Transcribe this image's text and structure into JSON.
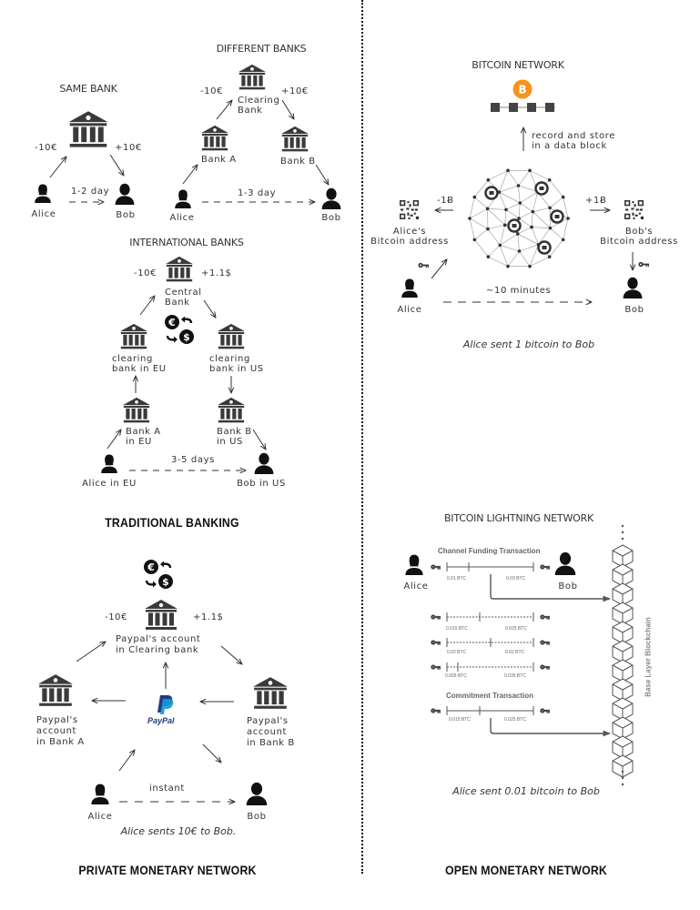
{
  "traditional_banking": {
    "section_title": "TRADITIONAL BANKING",
    "same_bank": {
      "title": "SAME BANK",
      "debit": "-10€",
      "credit": "+10€",
      "duration": "1-2 day",
      "sender": "Alice",
      "receiver": "Bob"
    },
    "different_banks": {
      "title": "DIFFERENT BANKS",
      "debit": "-10€",
      "credit": "+10€",
      "clearing_bank": [
        "Clearing",
        "Bank"
      ],
      "bank_a": "Bank A",
      "bank_b": "Bank B",
      "duration": "1-3 day",
      "sender": "Alice",
      "receiver": "Bob"
    },
    "international_banks": {
      "title": "INTERNATIONAL BANKS",
      "debit": "-10€",
      "credit": "+1.1$",
      "central_bank": [
        "Central",
        "Bank"
      ],
      "clearing_eu": [
        "clearing",
        "bank in EU"
      ],
      "clearing_us": [
        "clearing",
        "bank in US"
      ],
      "bank_a": [
        "Bank A",
        "in EU"
      ],
      "bank_b": [
        "Bank B",
        "in US"
      ],
      "duration": "3-5 days",
      "sender": "Alice in EU",
      "receiver": "Bob in US"
    }
  },
  "private_network": {
    "section_title": "PRIVATE MONETARY NETWORK",
    "debit": "-10€",
    "credit": "+1.1$",
    "clearing_account": [
      "Paypal's account",
      "in Clearing bank"
    ],
    "bank_a_account": [
      "Paypal's",
      "account",
      "in Bank A"
    ],
    "bank_b_account": [
      "Paypal's",
      "account",
      "in Bank B"
    ],
    "paypal_logo": "PayPal",
    "duration": "instant",
    "sender": "Alice",
    "receiver": "Bob",
    "caption": "Alice sents 10€ to Bob."
  },
  "bitcoin_network": {
    "title": "BITCOIN NETWORK",
    "record_label": [
      "record and store",
      "in a data block"
    ],
    "debit": "-1Ƀ",
    "credit": "+1Ƀ",
    "alice_address": [
      "Alice's",
      "Bitcoin address"
    ],
    "bob_address": [
      "Bob's",
      "Bitcoin address"
    ],
    "duration": "~10 minutes",
    "sender": "Alice",
    "receiver": "Bob",
    "caption": "Alice sent 1 bitcoin to Bob",
    "bitcoin_color": "#F7931A"
  },
  "lightning_network": {
    "title": "BITCOIN LIGHTNING NETWORK",
    "funding_label": "Channel Funding Transaction",
    "funding": [
      "0.01 BTC",
      "0.03 BTC"
    ],
    "updates": [
      [
        "0.015 BTC",
        "0.025 BTC"
      ],
      [
        "0.02 BTC",
        "0.02 BTC"
      ],
      [
        "0.005 BTC",
        "0.035 BTC"
      ]
    ],
    "commitment_label": "Commitment Transaction",
    "commitment": [
      "0.015 BTC",
      "0.025 BTC"
    ],
    "sender": "Alice",
    "receiver": "Bob",
    "blockchain_label": "Base Layer Blockchain",
    "caption": "Alice sent 0.01 bitcoin to Bob",
    "section_title": "OPEN MONETARY NETWORK"
  }
}
